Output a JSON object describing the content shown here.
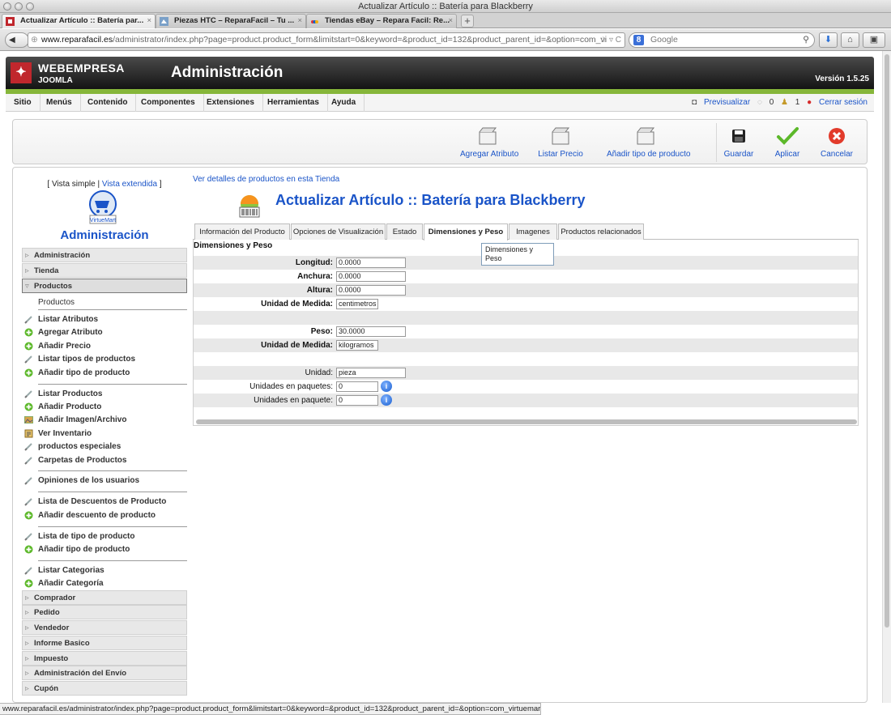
{
  "window": {
    "title": "Actualizar Artículo :: Batería para Blackberry"
  },
  "browser_tabs": [
    {
      "label": "Actualizar Artículo :: Batería par...",
      "icon": "joomla-favicon",
      "active": true
    },
    {
      "label": "Piezas HTC – ReparaFacil – Tu ...",
      "icon": "site-favicon",
      "active": false
    },
    {
      "label": "Tiendas eBay – Repara Facil: Re...",
      "icon": "ebay-favicon",
      "active": false
    }
  ],
  "tab_close": "×",
  "new_tab": "+",
  "navbar": {
    "url_host": "www.reparafacil.es",
    "url_path": "/administrator/index.php?page=product.product_form&limitstart=0&keyword=&product_id=132&product_parent_id=&option=com_vi",
    "url_end": "☆ ▿ C",
    "search_placeholder": "Google",
    "search_engine_badge": "8"
  },
  "header": {
    "brand_line1": "WEBEMPRESA",
    "brand_line2": "JOOMLA",
    "title": "Administración",
    "version": "Versión 1.5.25",
    "colors": {
      "accent_green": "#86b63a",
      "link_blue": "#1a54c8"
    }
  },
  "menu": [
    "Sitio",
    "Menús",
    "Contenido",
    "Componentes",
    "Extensiones",
    "Herramientas",
    "Ayuda"
  ],
  "status_menu": {
    "preview": "Previsualizar",
    "messages": "0",
    "users": "1",
    "logout": "Cerrar sesión"
  },
  "toolbar": {
    "buttons": [
      {
        "label": "Agregar Atributo",
        "icon": "box-icon"
      },
      {
        "label": "Listar Precio",
        "icon": "box-icon"
      },
      {
        "label": "Añadir tipo de producto",
        "icon": "box-icon"
      },
      {
        "label": "Guardar",
        "icon": "save-icon"
      },
      {
        "label": "Aplicar",
        "icon": "check-icon"
      },
      {
        "label": "Cancelar",
        "icon": "cancel-icon"
      }
    ]
  },
  "sidebar": {
    "view_simple": "Vista simple",
    "view_sep": " | ",
    "view_extended": "Vista extendida",
    "brackets": [
      "[ ",
      " ]"
    ],
    "logo_text": "VirtueMart",
    "title": "Administración",
    "sections_top": [
      "Administración",
      "Tienda",
      "Productos"
    ],
    "sub_products": "Productos",
    "groups": [
      [
        {
          "label": "Listar Atributos",
          "icon": "list-icon"
        },
        {
          "label": "Agregar Atributo",
          "icon": "add-icon"
        },
        {
          "label": "Añadir Precio",
          "icon": "add-icon"
        },
        {
          "label": "Listar tipos de productos",
          "icon": "list-icon"
        },
        {
          "label": "Añadir tipo de producto",
          "icon": "add-icon"
        }
      ],
      [
        {
          "label": "Listar Productos",
          "icon": "list-icon"
        },
        {
          "label": "Añadir Producto",
          "icon": "add-icon"
        },
        {
          "label": "Añadir Imagen/Archivo",
          "icon": "image-icon"
        },
        {
          "label": "Ver Inventario",
          "icon": "inventory-icon"
        },
        {
          "label": "productos especiales",
          "icon": "list-icon"
        },
        {
          "label": "Carpetas de Productos",
          "icon": "list-icon"
        }
      ],
      [
        {
          "label": "Opiniones de los usuarios",
          "icon": "list-icon"
        }
      ],
      [
        {
          "label": "Lista de Descuentos de Producto",
          "icon": "list-icon"
        },
        {
          "label": "Añadir descuento de producto",
          "icon": "add-icon"
        }
      ],
      [
        {
          "label": "Lista de tipo de producto",
          "icon": "list-icon"
        },
        {
          "label": "Añadir tipo de producto",
          "icon": "add-icon"
        }
      ],
      [
        {
          "label": "Listar Categorias",
          "icon": "list-icon"
        },
        {
          "label": "Añadir Categoría",
          "icon": "add-icon"
        }
      ]
    ],
    "sections_bottom": [
      "Comprador",
      "Pedido",
      "Vendedor",
      "Informe Basico",
      "Impuesto",
      "Administración del Envío",
      "Cupón"
    ]
  },
  "content": {
    "detail_link": "Ver detalles de productos en esta Tienda",
    "title": "Actualizar Artículo :: Batería para Blackberry",
    "tabs": [
      "Información del Producto",
      "Opciones de Visualización",
      "Estado",
      "Dimensiones y Peso",
      "Imagenes",
      "Productos relacionados"
    ],
    "active_tab": "Dimensiones y Peso",
    "tooltip": "Dimensiones y Peso",
    "panel_title": "Dimensiones y Peso",
    "fields": {
      "length": {
        "label": "Longitud:",
        "value": "0.0000"
      },
      "width": {
        "label": "Anchura:",
        "value": "0.0000"
      },
      "height": {
        "label": "Altura:",
        "value": "0.0000"
      },
      "dim_unit": {
        "label": "Unidad de Medida:",
        "value": "centimetros"
      },
      "weight": {
        "label": "Peso:",
        "value": "30.0000"
      },
      "weight_unit": {
        "label": "Unidad de Medida:",
        "value": "kilogramos"
      },
      "unit": {
        "label": "Unidad:",
        "value": "pieza"
      },
      "units_in_packages": {
        "label": "Unidades en paquetes:",
        "value": "0"
      },
      "units_in_package": {
        "label": "Unidades en paquete:",
        "value": "0"
      }
    },
    "help_glyph": "i"
  },
  "statusbar": {
    "text": "www.reparafacil.es/administrator/index.php?page=product.product_form&limitstart=0&keyword=&product_id=132&product_parent_id=&option=com_virtuemart#"
  }
}
